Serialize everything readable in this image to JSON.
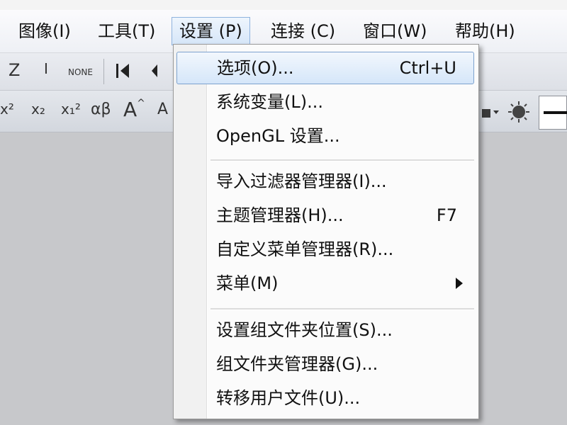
{
  "menubar": {
    "items": [
      {
        "label": "图像(I)"
      },
      {
        "label": "工具(T)"
      },
      {
        "label": "设置 (P)"
      },
      {
        "label": "连接 (C)"
      },
      {
        "label": "窗口(W)"
      },
      {
        "label": "帮助(H)"
      }
    ]
  },
  "toolbar": {
    "icons": [
      "z-glyph",
      "italic-glyph",
      "none-glyph",
      "align-left-icon",
      "superscript-icon",
      "subscript-icon",
      "super-sub-icon",
      "alpha-beta-icon",
      "font-size-increase-icon",
      "font-size-decrease-icon",
      "lamp-icon",
      "line-style-selector"
    ],
    "texts": {
      "z": "Z",
      "i": "I",
      "none": "NONE",
      "x2sup": "x²",
      "x2sub": "x₂",
      "x12": "x₁²",
      "ab": "αβ",
      "Aup": "A",
      "Adown": "A"
    }
  },
  "dropdown": {
    "items": [
      {
        "label": "选项(O)...",
        "shortcut": "Ctrl+U",
        "highlighted": true
      },
      {
        "label": "系统变量(L)..."
      },
      {
        "label": "OpenGL 设置..."
      },
      {
        "label": "导入过滤器管理器(I)..."
      },
      {
        "label": "主题管理器(H)...",
        "shortcut": "F7"
      },
      {
        "label": "自定义菜单管理器(R)..."
      },
      {
        "label": "菜单(M)",
        "submenu": true
      },
      {
        "label": "设置组文件夹位置(S)..."
      },
      {
        "label": "组文件夹管理器(G)..."
      },
      {
        "label": "转移用户文件(U)..."
      }
    ]
  },
  "colors": {
    "menu_highlight_border": "#7da2ce",
    "menu_highlight_fill": "#d5e6f9",
    "workspace": "#c7c8cb"
  }
}
